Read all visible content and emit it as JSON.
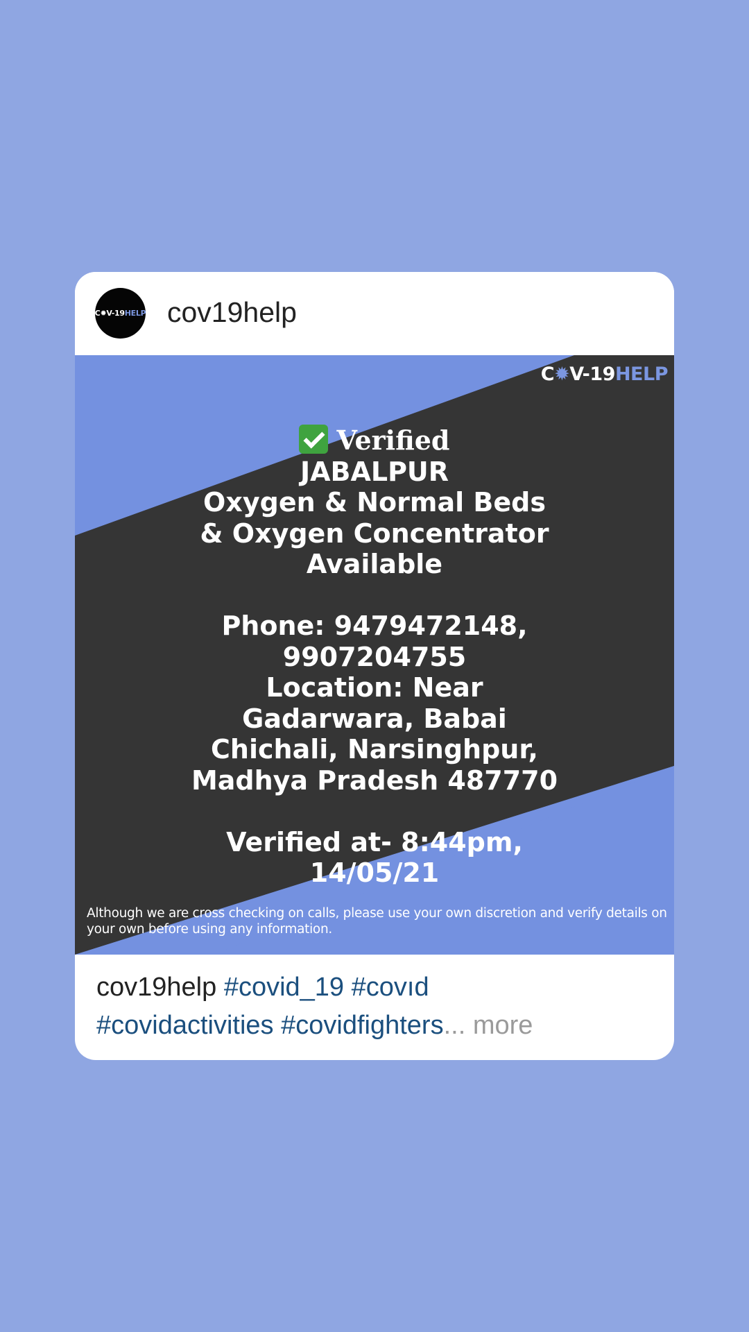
{
  "post": {
    "username": "cov19help",
    "avatar": {
      "logo_prefix": "C✹V-19",
      "logo_suffix": "HELP"
    },
    "image": {
      "brand_prefix": "C",
      "brand_virus": "✹",
      "brand_middle": "V-19",
      "brand_suffix": "HELP",
      "verified_label": "Verified",
      "lines": [
        "JABALPUR",
        "Oxygen & Normal Beds",
        "& Oxygen Concentrator",
        "Available"
      ],
      "contact_lines": [
        "Phone: 9479472148,",
        "9907204755",
        "Location: Near",
        "Gadarwara, Babai",
        "Chichali, Narsinghpur,",
        "Madhya Pradesh 487770"
      ],
      "verified_at_lines": [
        "Verified at- 8:44pm,",
        "14/05/21"
      ],
      "disclaimer": "Although we are cross checking on calls, please use your own discretion and verify details on your own before using any information."
    },
    "caption": {
      "username": "cov19help",
      "tag_1": "#covid_19",
      "tag_2": "#covıd",
      "tag_3": "#covidactivities",
      "tag_4": "#covidfighters",
      "ellipsis": "...",
      "more_label": "more"
    }
  },
  "colors": {
    "page_background": "#8fa6e2",
    "card": "#ffffff",
    "image_blue": "#7491e0",
    "image_dark": "#353535",
    "hashtag": "#1b4f7e",
    "more": "#9a9a9a"
  }
}
